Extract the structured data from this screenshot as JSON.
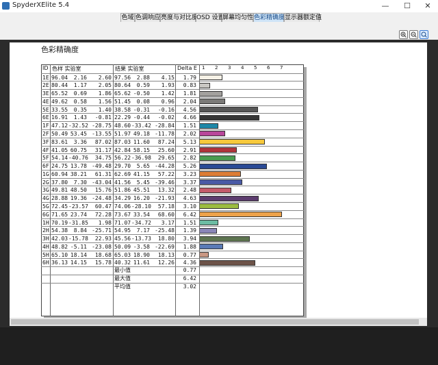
{
  "window": {
    "title": "SpyderXElite 5.4",
    "minimize_icon": "minimize-icon",
    "maximize_icon": "maximize-icon",
    "close_icon": "close-icon",
    "minimize_glyph": "—",
    "maximize_glyph": "☐",
    "close_glyph": "✕"
  },
  "tabs": [
    {
      "label": "色域",
      "active": false
    },
    {
      "label": "色调响应",
      "active": false
    },
    {
      "label": "亮度与对比度",
      "active": false
    },
    {
      "label": "OSD 设置",
      "active": false
    },
    {
      "label": "屏幕均匀性",
      "active": false
    },
    {
      "label": "色彩精确度",
      "active": true
    },
    {
      "label": "显示器额定值",
      "active": false
    }
  ],
  "zoom_buttons": [
    "zoom-in-icon",
    "zoom-out-icon",
    "zoom-fit-icon"
  ],
  "report": {
    "title": "色彩精确度",
    "headers": {
      "id": "ID",
      "sample": "色样 实验室",
      "result": "结果 实验室",
      "delta": "Delta E"
    },
    "scale_ticks": [
      "1",
      "2",
      "3",
      "4",
      "5",
      "6",
      "7"
    ],
    "rows": [
      {
        "id": "1E",
        "s": [
          "96.04",
          "2.16",
          "2.60"
        ],
        "r": [
          "97.56",
          "2.88",
          "4.15"
        ],
        "d": "1.79",
        "color": "#f5f1e6"
      },
      {
        "id": "2E",
        "s": [
          "80.44",
          "1.17",
          "2.05"
        ],
        "r": [
          "80.64",
          "0.59",
          "1.93"
        ],
        "d": "0.83",
        "color": "#c9c7c3"
      },
      {
        "id": "3E",
        "s": [
          "65.52",
          "0.69",
          "1.86"
        ],
        "r": [
          "65.62",
          "-0.50",
          "1.42"
        ],
        "d": "1.81",
        "color": "#a3a19e"
      },
      {
        "id": "4E",
        "s": [
          "49.62",
          "0.58",
          "1.56"
        ],
        "r": [
          "51.45",
          "0.08",
          "0.96"
        ],
        "d": "2.04",
        "color": "#7b7a78"
      },
      {
        "id": "5E",
        "s": [
          "33.55",
          "0.35",
          "1.40"
        ],
        "r": [
          "38.58",
          "-0.31",
          "-0.16"
        ],
        "d": "4.56",
        "color": "#565656"
      },
      {
        "id": "6E",
        "s": [
          "16.91",
          "1.43",
          "-0.81"
        ],
        "r": [
          "22.29",
          "-0.44",
          "-0.02"
        ],
        "d": "4.66",
        "color": "#353535"
      },
      {
        "id": "1F",
        "s": [
          "47.12",
          "-32.52",
          "-28.75"
        ],
        "r": [
          "48.60",
          "-33.42",
          "-28.84"
        ],
        "d": "1.51",
        "color": "#1e88a8"
      },
      {
        "id": "2F",
        "s": [
          "50.49",
          "53.45",
          "-13.55"
        ],
        "r": [
          "51.97",
          "49.18",
          "-11.78"
        ],
        "d": "2.02",
        "color": "#b8479a"
      },
      {
        "id": "3F",
        "s": [
          "83.61",
          "3.36",
          "87.02"
        ],
        "r": [
          "87.03",
          "11.60",
          "87.24"
        ],
        "d": "5.13",
        "color": "#f7c93c"
      },
      {
        "id": "4F",
        "s": [
          "41.05",
          "60.75",
          "31.17"
        ],
        "r": [
          "42.84",
          "58.15",
          "25.60"
        ],
        "d": "2.91",
        "color": "#b0343b"
      },
      {
        "id": "5F",
        "s": [
          "54.14",
          "-40.76",
          "34.75"
        ],
        "r": [
          "56.22",
          "-36.98",
          "29.65"
        ],
        "d": "2.82",
        "color": "#4a9c50"
      },
      {
        "id": "6F",
        "s": [
          "24.75",
          "13.78",
          "-49.48"
        ],
        "r": [
          "29.70",
          "5.65",
          "-44.28"
        ],
        "d": "5.26",
        "color": "#2a4a95"
      },
      {
        "id": "1G",
        "s": [
          "60.94",
          "38.21",
          "61.31"
        ],
        "r": [
          "62.69",
          "41.15",
          "57.22"
        ],
        "d": "3.23",
        "color": "#dd7d36"
      },
      {
        "id": "2G",
        "s": [
          "37.80",
          "7.30",
          "-43.04"
        ],
        "r": [
          "41.56",
          "5.45",
          "-39.46"
        ],
        "d": "3.37",
        "color": "#4a5aa6"
      },
      {
        "id": "3G",
        "s": [
          "49.81",
          "48.50",
          "15.76"
        ],
        "r": [
          "51.86",
          "45.51",
          "13.32"
        ],
        "d": "2.48",
        "color": "#c35a6a"
      },
      {
        "id": "4G",
        "s": [
          "28.88",
          "19.36",
          "-24.48"
        ],
        "r": [
          "34.29",
          "16.20",
          "-21.93"
        ],
        "d": "4.63",
        "color": "#5c3c6e"
      },
      {
        "id": "5G",
        "s": [
          "72.45",
          "-23.57",
          "60.47"
        ],
        "r": [
          "74.06",
          "-28.10",
          "57.18"
        ],
        "d": "3.10",
        "color": "#9cbc40"
      },
      {
        "id": "6G",
        "s": [
          "71.65",
          "23.74",
          "72.28"
        ],
        "r": [
          "73.67",
          "33.54",
          "68.60"
        ],
        "d": "6.42",
        "color": "#eda24a"
      },
      {
        "id": "1H",
        "s": [
          "70.19",
          "-31.85",
          "1.98"
        ],
        "r": [
          "71.07",
          "-34.72",
          "3.17"
        ],
        "d": "1.51",
        "color": "#6cbca3"
      },
      {
        "id": "2H",
        "s": [
          "54.38",
          "8.84",
          "-25.71"
        ],
        "r": [
          "54.95",
          "7.17",
          "-25.48"
        ],
        "d": "1.39",
        "color": "#8a86b8"
      },
      {
        "id": "3H",
        "s": [
          "42.03",
          "-15.78",
          "22.93"
        ],
        "r": [
          "45.56",
          "-13.73",
          "18.80"
        ],
        "d": "3.94",
        "color": "#5e7550"
      },
      {
        "id": "4H",
        "s": [
          "48.82",
          "-5.11",
          "-23.08"
        ],
        "r": [
          "50.09",
          "-3.58",
          "-22.69"
        ],
        "d": "1.88",
        "color": "#5a7ab6"
      },
      {
        "id": "5H",
        "s": [
          "65.10",
          "18.14",
          "18.68"
        ],
        "r": [
          "65.03",
          "18.90",
          "18.13"
        ],
        "d": "0.77",
        "color": "#c99783"
      },
      {
        "id": "6H",
        "s": [
          "36.13",
          "14.15",
          "15.78"
        ],
        "r": [
          "40.32",
          "11.61",
          "12.26"
        ],
        "d": "4.36",
        "color": "#6d5349"
      }
    ],
    "summary": [
      {
        "label": "最小值",
        "value": "0.77"
      },
      {
        "label": "最大值",
        "value": "6.42"
      },
      {
        "label": "平均值",
        "value": "3.02"
      }
    ]
  }
}
